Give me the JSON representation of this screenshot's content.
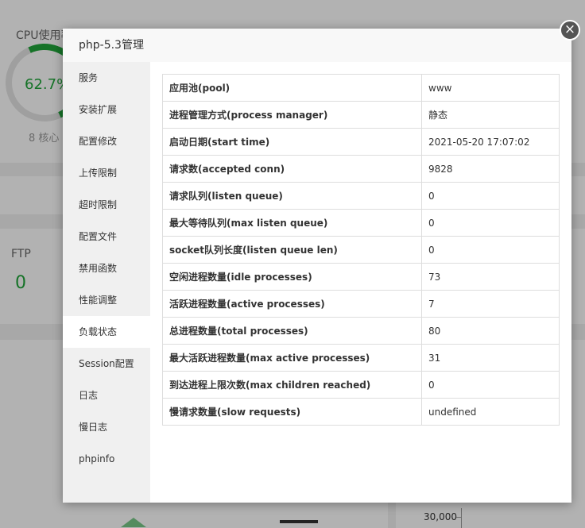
{
  "background": {
    "cpu_label": "CPU使用率",
    "cpu_value": "62.7%",
    "cores": "8 核心",
    "ftp_label": "FTP",
    "ftp_value": "0",
    "axis_tick": "30,000"
  },
  "modal": {
    "title": "php-5.3管理",
    "close_symbol": "×",
    "sidebar_items": [
      {
        "label": "服务"
      },
      {
        "label": "安装扩展"
      },
      {
        "label": "配置修改"
      },
      {
        "label": "上传限制"
      },
      {
        "label": "超时限制"
      },
      {
        "label": "配置文件"
      },
      {
        "label": "禁用函数"
      },
      {
        "label": "性能调整"
      },
      {
        "label": "负载状态",
        "active": true
      },
      {
        "label": "Session配置"
      },
      {
        "label": "日志"
      },
      {
        "label": "慢日志"
      },
      {
        "label": "phpinfo"
      }
    ],
    "table": [
      {
        "key": "应用池(pool)",
        "value": "www"
      },
      {
        "key": "进程管理方式(process manager)",
        "value": "静态"
      },
      {
        "key": "启动日期(start time)",
        "value": "2021-05-20 17:07:02"
      },
      {
        "key": "请求数(accepted conn)",
        "value": "9828"
      },
      {
        "key": "请求队列(listen queue)",
        "value": "0"
      },
      {
        "key": "最大等待队列(max listen queue)",
        "value": "0"
      },
      {
        "key": "socket队列长度(listen queue len)",
        "value": "0"
      },
      {
        "key": "空闲进程数量(idle processes)",
        "value": "73"
      },
      {
        "key": "活跃进程数量(active processes)",
        "value": "7"
      },
      {
        "key": "总进程数量(total processes)",
        "value": "80"
      },
      {
        "key": "最大活跃进程数量(max active processes)",
        "value": "31"
      },
      {
        "key": "到达进程上限次数(max children reached)",
        "value": "0"
      },
      {
        "key": "慢请求数量(slow requests)",
        "value": "undefined"
      }
    ]
  },
  "colors": {
    "accent_green": "#20a53a",
    "sidebar_bg": "#f0f0f0",
    "border": "#dddddd"
  }
}
